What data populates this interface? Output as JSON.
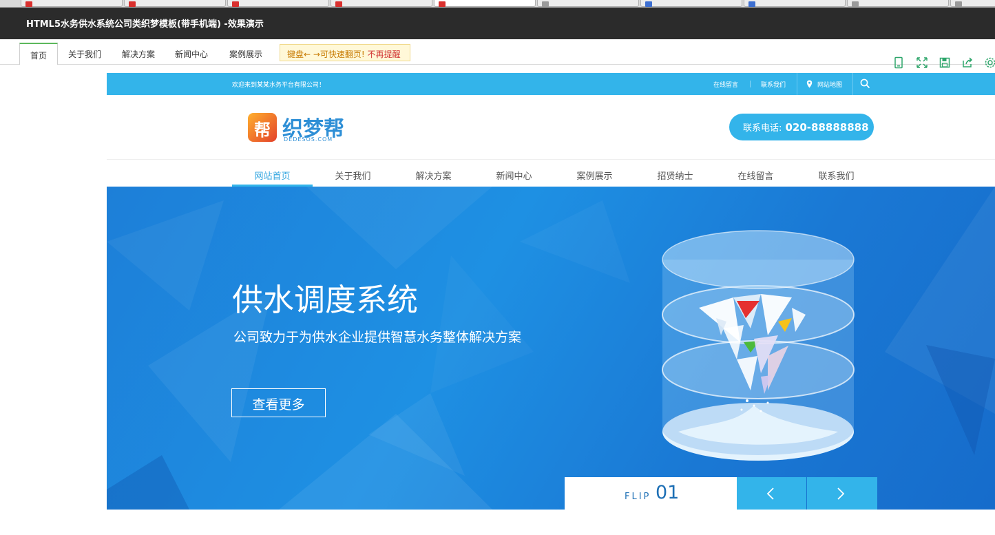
{
  "demo": {
    "title": "HTML5水务供水系统公司类织梦模板(带手机端) -效果演示",
    "tabs": [
      "首页",
      "关于我们",
      "解决方案",
      "新闻中心",
      "案例展示"
    ],
    "key_hint": "键盘← →可快速翻页!",
    "no_remind": "不再提醒",
    "tool_icons": [
      "mobile-icon",
      "fullscreen-icon",
      "save-icon",
      "share-icon",
      "settings-icon"
    ]
  },
  "topbar": {
    "welcome": "欢迎来到某某水务平台有限公司！",
    "links": [
      "在线留言",
      "联系我们",
      "网站地图"
    ]
  },
  "header": {
    "logo_mark": "帮",
    "logo_text": "织梦帮",
    "logo_sub": "DEDESOS.COM",
    "phone_label": "联系电话:",
    "phone_number": "020-88888888"
  },
  "nav": [
    "网站首页",
    "关于我们",
    "解决方案",
    "新闻中心",
    "案例展示",
    "招贤纳士",
    "在线留言",
    "联系我们"
  ],
  "banner": {
    "title": "供水调度系统",
    "subtitle": "公司致力于为供水企业提供智慧水务整体解决方案",
    "more": "查看更多",
    "flip_label": "FLIP",
    "flip_num": "01"
  },
  "colors": {
    "accent": "#33b4ea",
    "demo_bar": "#2b2b2b",
    "banner": "#1d87de"
  }
}
